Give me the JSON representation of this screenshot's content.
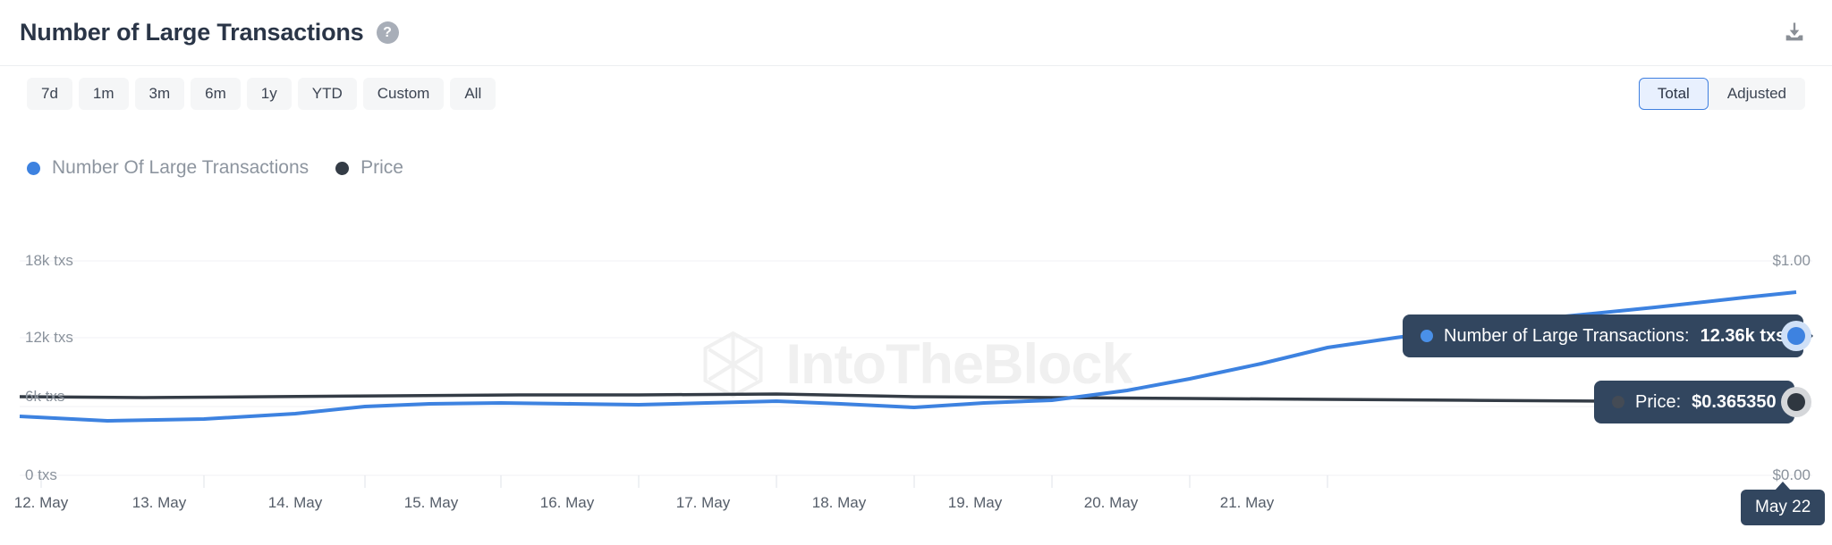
{
  "header": {
    "title": "Number of Large Transactions",
    "help_icon": "question-mark-circle-icon",
    "download_icon": "download-icon"
  },
  "controls": {
    "ranges": [
      {
        "label": "7d",
        "active": false
      },
      {
        "label": "1m",
        "active": false
      },
      {
        "label": "3m",
        "active": false
      },
      {
        "label": "6m",
        "active": false
      },
      {
        "label": "1y",
        "active": false
      },
      {
        "label": "YTD",
        "active": false
      },
      {
        "label": "Custom",
        "active": false
      },
      {
        "label": "All",
        "active": false
      }
    ],
    "toggle": [
      {
        "label": "Total",
        "active": true
      },
      {
        "label": "Adjusted",
        "active": false
      }
    ]
  },
  "legend": [
    {
      "label": "Number Of Large Transactions",
      "color": "#3d82e0"
    },
    {
      "label": "Price",
      "color": "#343c46"
    }
  ],
  "tooltips": {
    "transactions": {
      "prefix": "Number of Large Transactions:",
      "value": "12.36k txs",
      "dot_color": "#3d82e0"
    },
    "price": {
      "prefix": "Price:",
      "value": "$0.365350",
      "dot_color": "#343c46"
    },
    "date_badge": "May 22"
  },
  "colors": {
    "transactions_line": "#3d82e0",
    "price_line": "#343c46",
    "accent": "#3f7fe0",
    "tooltip_bg": "#32465f",
    "grid": "#f2f3f5"
  },
  "watermark": {
    "text": "IntoTheBlock",
    "logo_icon": "intotheblock-logo-icon"
  },
  "chart_data": {
    "type": "line",
    "title": "Number of Large Transactions",
    "xlabel": "",
    "ylabel": "Number of Large Transactions",
    "ylabel_right": "Price",
    "grid": true,
    "legend_position": "top-left",
    "x": [
      "12. May",
      "13. May",
      "14. May",
      "15. May",
      "16. May",
      "17. May",
      "18. May",
      "19. May",
      "20. May",
      "21. May",
      "May 22"
    ],
    "yticks_left": [
      "0 txs",
      "6k txs",
      "12k txs",
      "18k txs"
    ],
    "yticks_left_values": [
      0,
      6000,
      12000,
      18000
    ],
    "ylim_left": [
      0,
      18000
    ],
    "yticks_right": [
      "$0.00",
      "$1.00"
    ],
    "yticks_right_values": [
      0,
      1
    ],
    "ylim_right": [
      0,
      1
    ],
    "series": [
      {
        "name": "Number Of Large Transactions",
        "axis": "left",
        "color": "#3d82e0",
        "unit": "txs",
        "values": [
          5250,
          4900,
          5150,
          5950,
          5800,
          6150,
          5700,
          6350,
          7900,
          9900,
          12360
        ]
      },
      {
        "name": "Price",
        "axis": "right",
        "color": "#343c46",
        "unit": "USD",
        "values": [
          0.372,
          0.37,
          0.371,
          0.373,
          0.372,
          0.374,
          0.369,
          0.368,
          0.367,
          0.366,
          0.36535
        ]
      }
    ],
    "annotations": [
      {
        "label": "Number of Large Transactions: 12.36k txs",
        "x": "May 22",
        "y": 12360
      },
      {
        "label": "Price: $0.365350",
        "x": "May 22",
        "y": 0.36535
      }
    ]
  }
}
